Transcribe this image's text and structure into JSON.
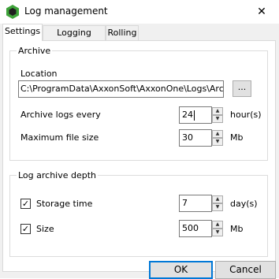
{
  "window": {
    "title": "Log management",
    "close_glyph": "✕",
    "icon": "axxon-hexagon-icon"
  },
  "tabs": [
    {
      "label": "Settings",
      "active": true
    },
    {
      "label": "Logging levels",
      "active": false
    },
    {
      "label": "Rolling",
      "active": false
    }
  ],
  "archive": {
    "legend": "Archive",
    "location_label": "Location",
    "location_value": "C:\\ProgramData\\AxxonSoft\\AxxonOne\\Logs\\Archive",
    "browse_label": "...",
    "interval_label": "Archive logs every",
    "interval_value": "24",
    "interval_unit": "hour(s)",
    "max_size_label": "Maximum file size",
    "max_size_value": "30",
    "max_size_unit": "Mb"
  },
  "depth": {
    "legend": "Log archive depth",
    "storage_time_label": "Storage time",
    "storage_time_checked": true,
    "storage_time_value": "7",
    "storage_time_unit": "day(s)",
    "size_label": "Size",
    "size_checked": true,
    "size_value": "500",
    "size_unit": "Mb"
  },
  "buttons": {
    "ok": "OK",
    "cancel": "Cancel"
  },
  "glyphs": {
    "check": "✓",
    "up": "▲",
    "down": "▼"
  },
  "colors": {
    "accent": "#0078d7",
    "icon_green": "#3fa33a"
  }
}
